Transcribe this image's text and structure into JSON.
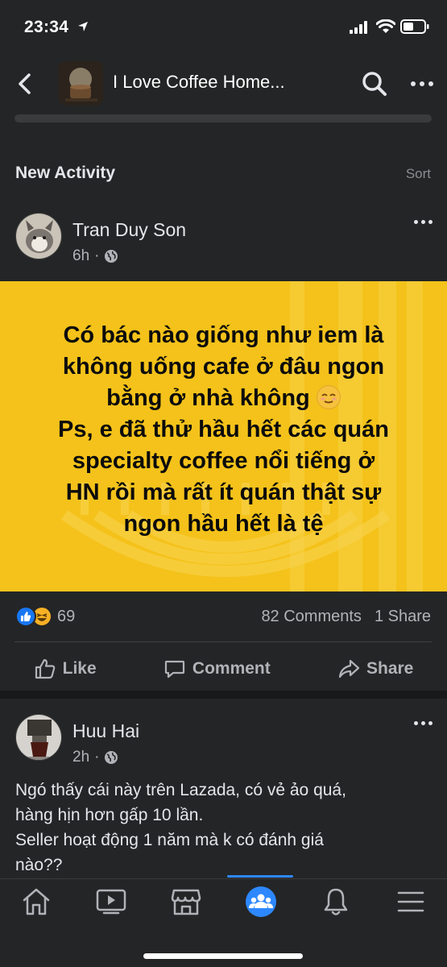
{
  "status_bar": {
    "time": "23:34"
  },
  "header": {
    "title": "I Love Coffee Home..."
  },
  "section": {
    "title": "New Activity",
    "sort_label": "Sort"
  },
  "posts": [
    {
      "author": "Tran Duy Son",
      "time": "6h",
      "separator": "·",
      "text_lines": [
        "Có bác nào giống như iem là",
        "không uống cafe ở đâu ngon",
        "bằng ở nhà không",
        "Ps, e đã thử hầu hết các quán",
        "specialty coffee nổi tiếng ở",
        "HN rồi mà rất ít quán thật sự",
        "ngon hầu hết là tệ"
      ],
      "reaction_count": "69",
      "comments": "82 Comments",
      "shares": "1 Share",
      "background_color": "#f4c21a"
    },
    {
      "author": "Huu Hai",
      "time": "2h",
      "separator": "·",
      "text_lines": [
        "Ngó thấy cái này trên Lazada, có vẻ ảo quá,",
        "hàng hịn hơn gấp 10 lần.",
        "Seller hoạt động 1 năm mà k có đánh giá",
        "nào??"
      ]
    }
  ],
  "actions": {
    "like": "Like",
    "comment": "Comment",
    "share": "Share"
  },
  "tabs": [
    "home-icon",
    "video-icon",
    "marketplace-icon",
    "groups-icon",
    "notifications-icon",
    "menu-icon"
  ],
  "colors": {
    "accent": "#2d88ff",
    "background": "#18191a",
    "surface": "#242526"
  }
}
